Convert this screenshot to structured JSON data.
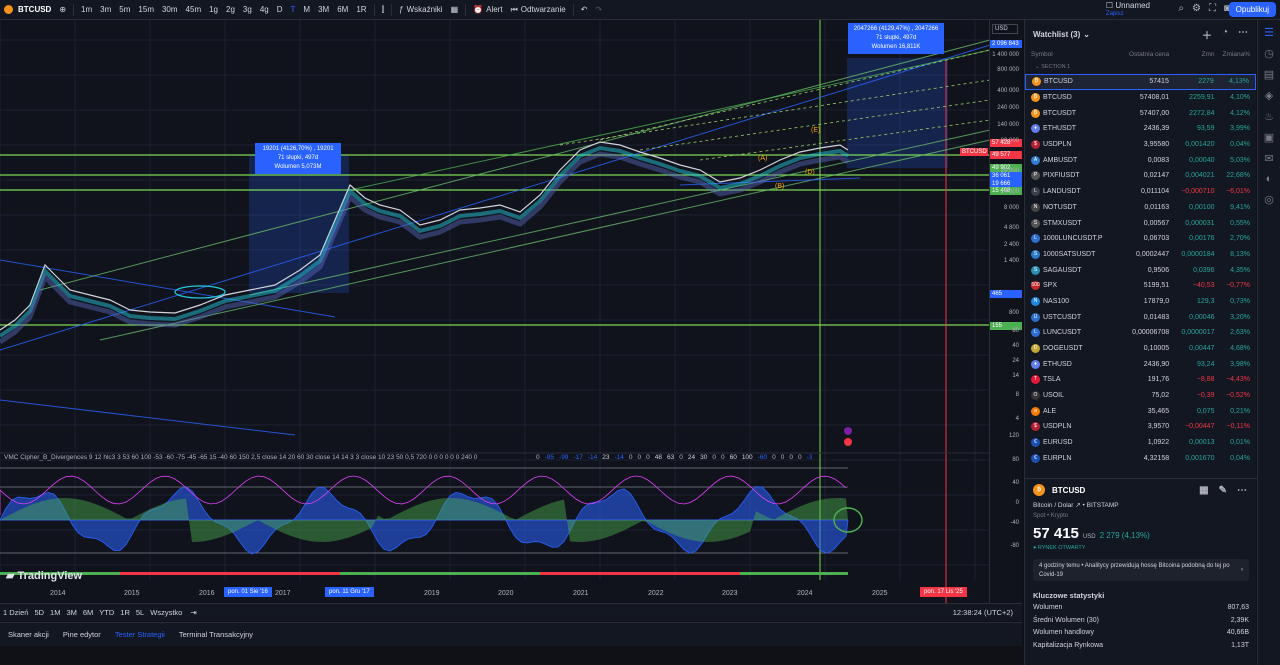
{
  "topbar": {
    "ticker": "BTCUSD",
    "intervals": [
      "1m",
      "3m",
      "5m",
      "15m",
      "30m",
      "45m",
      "1g",
      "2g",
      "3g",
      "4g",
      "D",
      "T",
      "M",
      "3M",
      "6M",
      "1R"
    ],
    "active_interval": "T",
    "indicators_label": "Wskaźniki",
    "alert_label": "Alert",
    "replay_label": "Odtwarzanie",
    "layout_name": "Unnamed",
    "layout_status": "Zapisz",
    "publish_label": "Opublikuj"
  },
  "chart": {
    "price_ticks": [
      "1 400 000",
      "800 000",
      "400 000",
      "240 000",
      "140 000",
      "80 000",
      "24 000",
      "14 000",
      "8 000",
      "4 800",
      "2 400",
      "1 400",
      "800",
      "80",
      "40",
      "24",
      "14",
      "8",
      "4"
    ],
    "price_markers": {
      "top": "2 096 843",
      "btc": "57 428",
      "b1": "49 577",
      "b2": "49 902",
      "b3": "36 061",
      "b4": "19 666",
      "b5": "15 498",
      "m465": "465",
      "m155": "155",
      "usd": "USD",
      "btc_tag": "BTCUSD"
    },
    "osc_ticks": [
      "120",
      "80",
      "40",
      "0",
      "-40",
      "-80"
    ],
    "years": [
      "2014",
      "2015",
      "2016",
      "2017",
      "2019",
      "2020",
      "2021",
      "2022",
      "2023",
      "2024",
      "2025"
    ],
    "indicator_title": "VMC Cipher_B_Divergences 9 12 hlc3 3 53 60 100 -53 -60 -75 -45 -65 15 -40 60 150 2,5 close 14 20 60 30 close 14 14 3 3 close 10 23 50 0,5 720 0 0 0 0 0 0 240 0",
    "indicator_values": [
      "0",
      "-95",
      "-99",
      "-17",
      "-14",
      "23",
      "-14",
      "0",
      "0",
      "0",
      "48",
      "63",
      "0",
      "24",
      "30",
      "0",
      "0",
      "60",
      "100",
      "-60",
      "0",
      "0",
      "0",
      "0",
      "-3"
    ],
    "callout_left": [
      "19201 (4126,70%) , 19201",
      "71 słupki, 497d",
      "Wolumen 5,073M"
    ],
    "callout_right": [
      "2047266 (4129,47%) , 2047266",
      "71 słupki, 497d",
      "Wolumen 16,811K"
    ],
    "wave_labels": [
      "(A)",
      "(B)",
      "(D)",
      "(E)"
    ],
    "date_flags": [
      "pon. 01 Sie '16",
      "pon. 11 Gru '17",
      "pon. 17 Lis '25"
    ],
    "watermark": "TradingView"
  },
  "bottom": {
    "ranges": [
      "1 Dzień",
      "5D",
      "1M",
      "3M",
      "6M",
      "YTD",
      "1R",
      "5L",
      "Wszystko"
    ],
    "clock": "12:38:24 (UTC+2)",
    "tabs": [
      "Skaner akcji",
      "Pine edytor",
      "Tester Strategii",
      "Terminal Transakcyjny"
    ],
    "active_tab": "Tester Strategii"
  },
  "watchlist": {
    "title": "Watchlist (3)",
    "col_symbol": "Symbol",
    "col_price": "Ostatnia cena",
    "col_chg": "Zmn",
    "col_pct": "Zmiana%",
    "section": "SECTION 1",
    "rows": [
      {
        "sym": "BTCUSD",
        "price": "57415",
        "chg": "2279",
        "pct": "4,13%",
        "dir": "up",
        "color": "#f7931a",
        "ic": "₿"
      },
      {
        "sym": "BTCUSD",
        "price": "57408,01",
        "chg": "2259,91",
        "pct": "4,10%",
        "dir": "up",
        "color": "#f7931a",
        "ic": "₿"
      },
      {
        "sym": "BTCUSDT",
        "price": "57407,00",
        "chg": "2272,84",
        "pct": "4,12%",
        "dir": "up",
        "color": "#f7931a",
        "ic": "₿"
      },
      {
        "sym": "ETHUSDT",
        "price": "2436,39",
        "chg": "93,59",
        "pct": "3,99%",
        "dir": "up",
        "color": "#627eea",
        "ic": "♦"
      },
      {
        "sym": "USDPLN",
        "price": "3,95580",
        "chg": "0,001420",
        "pct": "0,04%",
        "dir": "up",
        "color": "#b22234",
        "ic": "$"
      },
      {
        "sym": "AMBUSDT",
        "price": "0,0083",
        "chg": "0,00040",
        "pct": "5,03%",
        "dir": "up",
        "color": "#2e7dd1",
        "ic": "A"
      },
      {
        "sym": "PIXFIUSDT",
        "price": "0,02147",
        "chg": "0,004021",
        "pct": "22,68%",
        "dir": "up",
        "color": "#555",
        "ic": "P"
      },
      {
        "sym": "LANDUSDT",
        "price": "0,011104",
        "chg": "−0,000710",
        "pct": "−6,01%",
        "dir": "dn",
        "color": "#3b3f4a",
        "ic": "L"
      },
      {
        "sym": "NOTUSDT",
        "price": "0,01163",
        "chg": "0,00100",
        "pct": "9,41%",
        "dir": "up",
        "color": "#444",
        "ic": "N"
      },
      {
        "sym": "STMXUSDT",
        "price": "0,00567",
        "chg": "0,000031",
        "pct": "0,55%",
        "dir": "up",
        "color": "#555",
        "ic": "S"
      },
      {
        "sym": "1000LUNCUSDT.P",
        "price": "0,06703",
        "chg": "0,00176",
        "pct": "2,70%",
        "dir": "up",
        "color": "#2d6fd1",
        "ic": "L"
      },
      {
        "sym": "1000SATSUSDT",
        "price": "0,0002447",
        "chg": "0,0000184",
        "pct": "8,13%",
        "dir": "up",
        "color": "#2a7cc9",
        "ic": "S"
      },
      {
        "sym": "SAGAUSDT",
        "price": "0,9506",
        "chg": "0,0396",
        "pct": "4,35%",
        "dir": "up",
        "color": "#2a8fb0",
        "ic": "S"
      },
      {
        "sym": "SPX",
        "price": "5199,51",
        "chg": "−40,53",
        "pct": "−0,77%",
        "dir": "dn",
        "color": "#c62828",
        "ic": "500"
      },
      {
        "sym": "NAS100",
        "price": "17879,0",
        "chg": "129,3",
        "pct": "0,73%",
        "dir": "up",
        "color": "#1e88e5",
        "ic": "N"
      },
      {
        "sym": "USTCUSDT",
        "price": "0,01483",
        "chg": "0,00046",
        "pct": "3,20%",
        "dir": "up",
        "color": "#2a6fc9",
        "ic": "U"
      },
      {
        "sym": "LUNCUSDT",
        "price": "0,00006708",
        "chg": "0,0000017",
        "pct": "2,63%",
        "dir": "up",
        "color": "#2d6fd1",
        "ic": "L"
      },
      {
        "sym": "DOGEUSDT",
        "price": "0,10005",
        "chg": "0,00447",
        "pct": "4,68%",
        "dir": "up",
        "color": "#c2a633",
        "ic": "D"
      },
      {
        "sym": "ETHUSD",
        "price": "2436,90",
        "chg": "93,24",
        "pct": "3,98%",
        "dir": "up",
        "color": "#627eea",
        "ic": "♦"
      },
      {
        "sym": "TSLA",
        "price": "191,76",
        "chg": "−8,88",
        "pct": "−4,43%",
        "dir": "dn",
        "color": "#e31937",
        "ic": "T"
      },
      {
        "sym": "USOIL",
        "price": "75,02",
        "chg": "−0,39",
        "pct": "−0,52%",
        "dir": "dn",
        "color": "#333",
        "ic": "O"
      },
      {
        "sym": "ALE",
        "price": "35,465",
        "chg": "0,075",
        "pct": "0,21%",
        "dir": "up",
        "color": "#f57c00",
        "ic": "a"
      },
      {
        "sym": "USDPLN",
        "price": "3,9570",
        "chg": "−0,00447",
        "pct": "−0,11%",
        "dir": "dn",
        "color": "#b22234",
        "ic": "$"
      },
      {
        "sym": "EURUSD",
        "price": "1,0922",
        "chg": "0,00013",
        "pct": "0,01%",
        "dir": "up",
        "color": "#1a4fb4",
        "ic": "€"
      },
      {
        "sym": "EURPLN",
        "price": "4,32158",
        "chg": "0,001670",
        "pct": "0,04%",
        "dir": "up",
        "color": "#1a4fb4",
        "ic": "€"
      }
    ]
  },
  "detail": {
    "ticker": "BTCUSD",
    "name": "Bitcoin / Dolar",
    "exchange": "BITSTAMP",
    "type": "Spot • Krypto",
    "price": "57 415",
    "currency": "USD",
    "change": "2 279 (4,13%)",
    "market": "● RYNEK OTWARTY",
    "news": "4 godziny temu • Analitycy przewidują hossę Bitcoina podobną do tej po Covid-19",
    "stats_title": "Kluczowe statystyki",
    "stats": [
      {
        "label": "Wolumen",
        "value": "807,63"
      },
      {
        "label": "Średni Wolumen (30)",
        "value": "2,39K"
      },
      {
        "label": "Wolumen handlowy",
        "value": "40,66B"
      },
      {
        "label": "Kapitalizacja Rynkowa",
        "value": "1,13T"
      }
    ]
  }
}
